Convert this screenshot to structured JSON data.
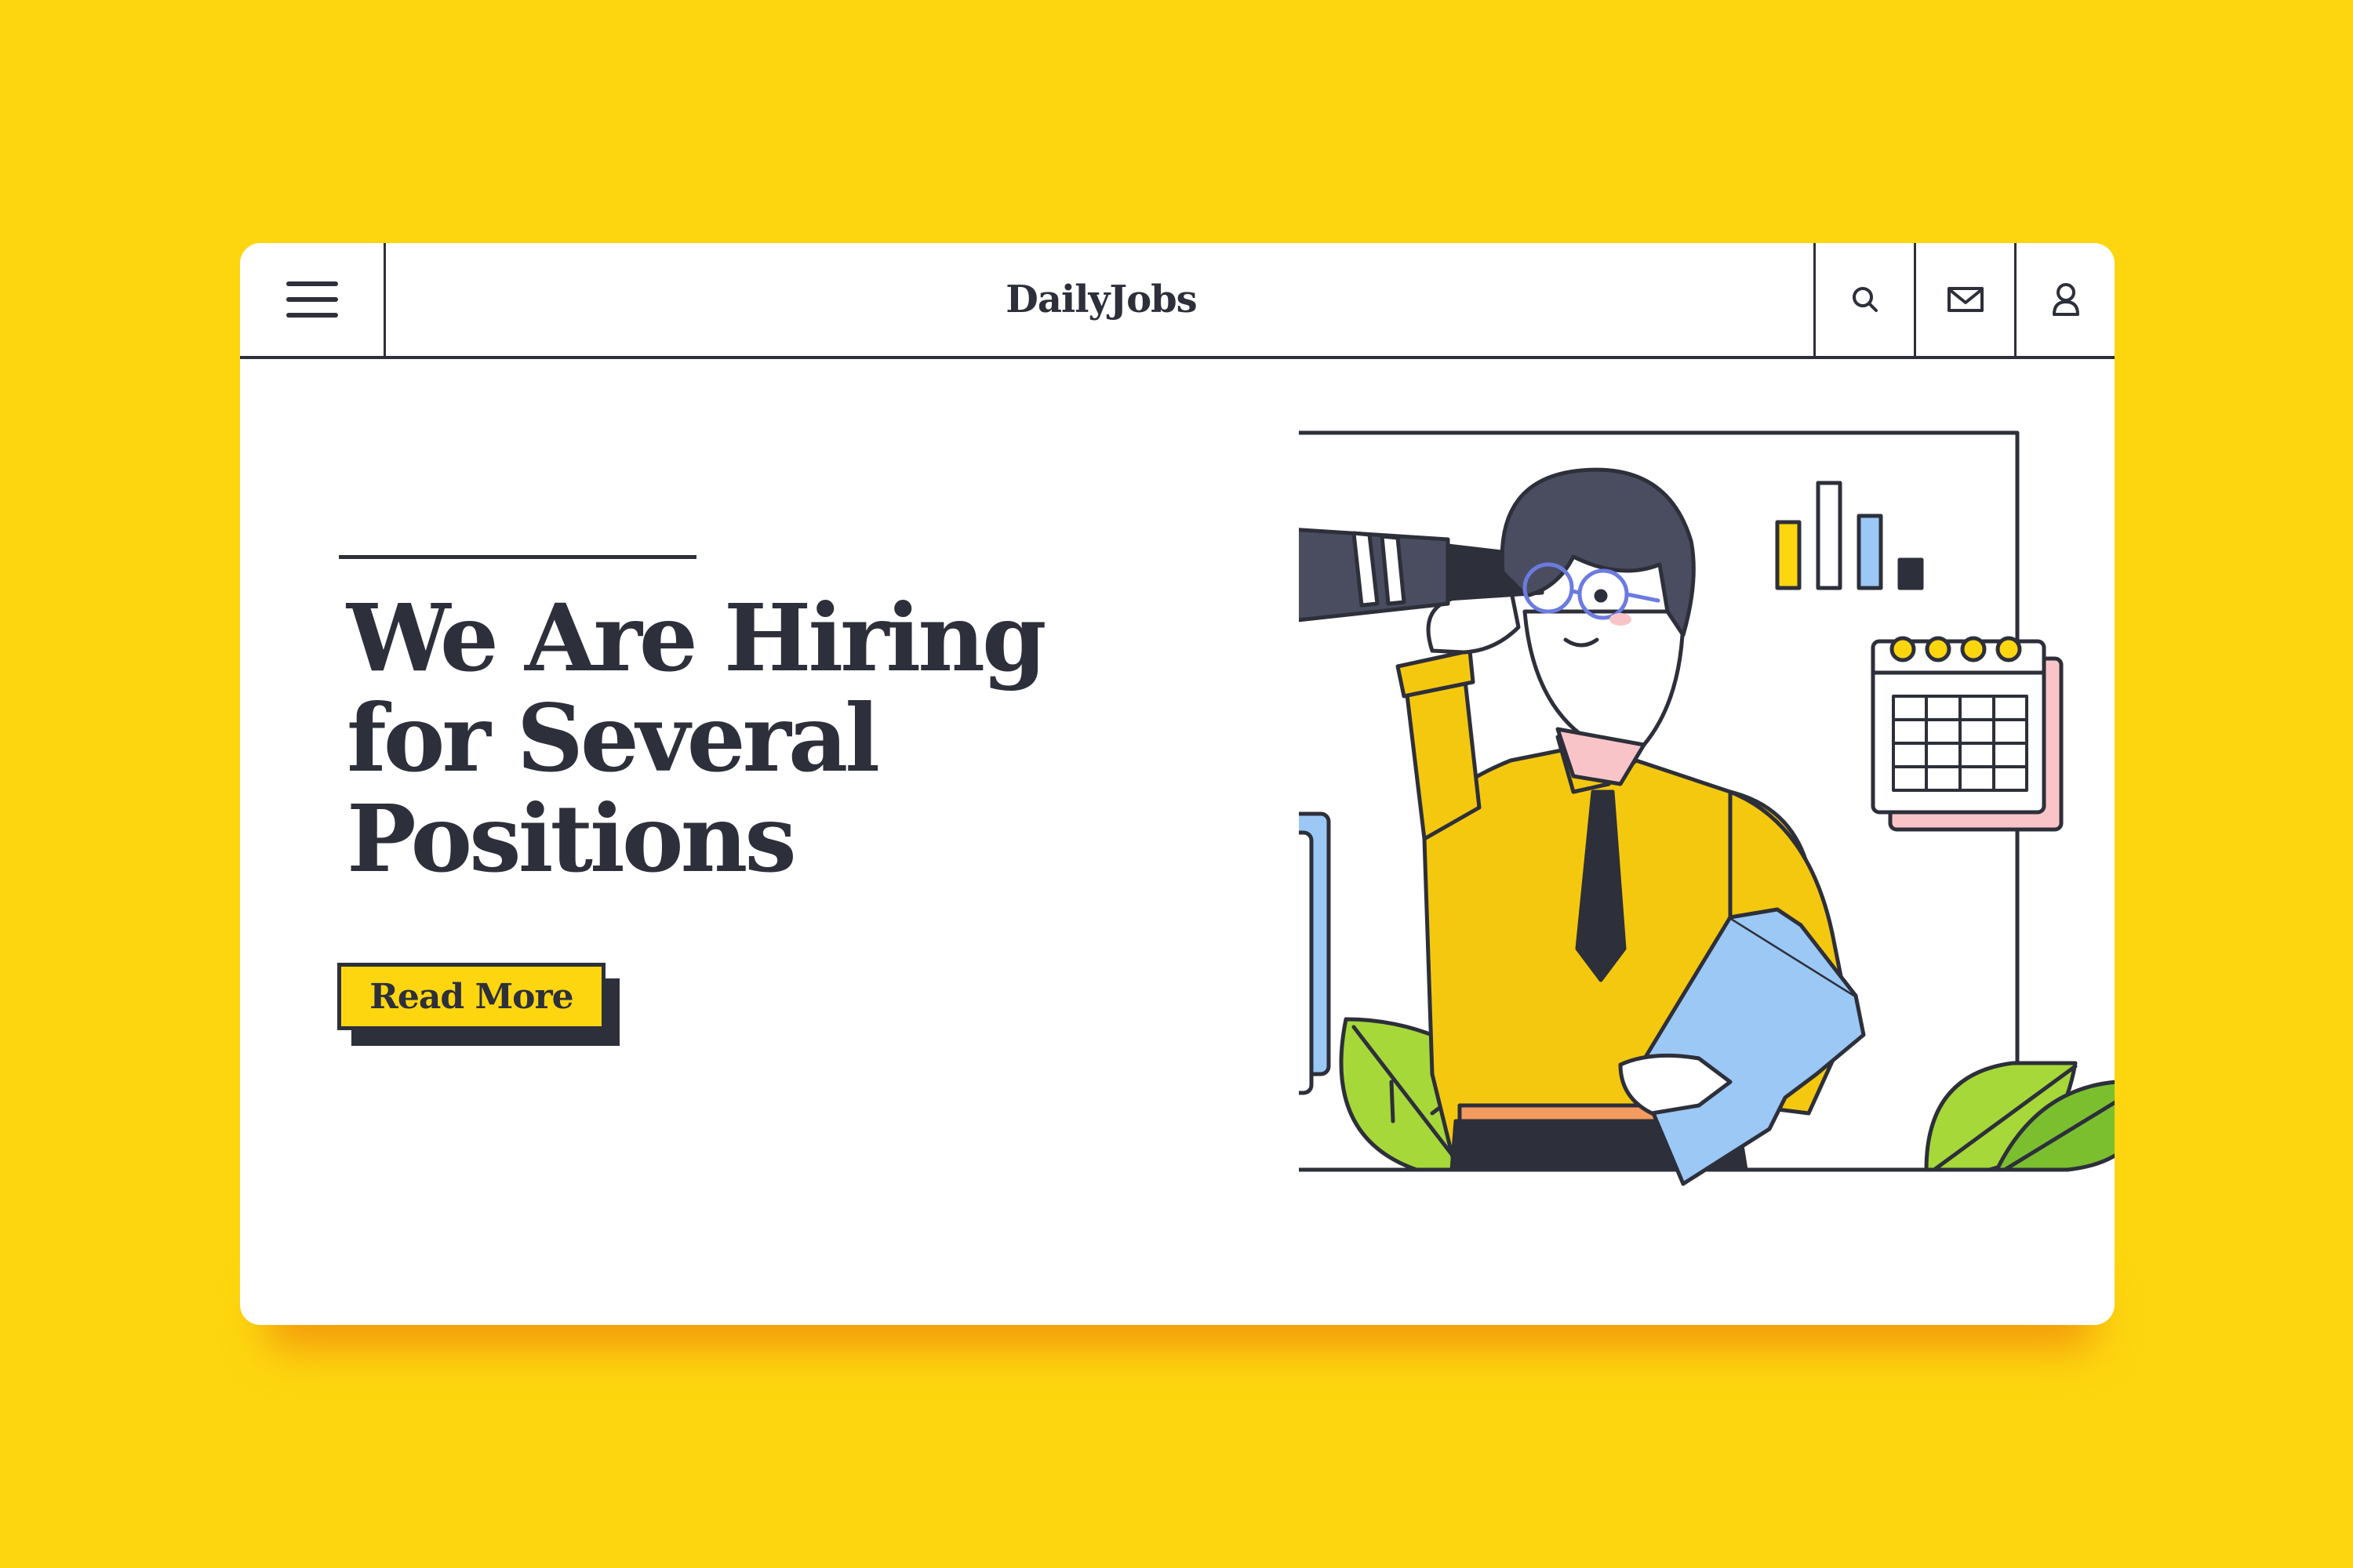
{
  "navbar": {
    "brand": "DailyJobs",
    "menu_icon": "hamburger-menu-icon",
    "actions": [
      {
        "name": "search",
        "icon": "search-icon"
      },
      {
        "name": "messages",
        "icon": "mail-icon"
      },
      {
        "name": "account",
        "icon": "user-icon"
      }
    ]
  },
  "hero": {
    "headline_lines": [
      "We Are Hiring",
      "for Several",
      "Positions"
    ],
    "cta_label": "Read More"
  },
  "colors": {
    "background": "#FDD60F",
    "accent": "#FDD60F",
    "text": "#2d2f3a",
    "card": "#ffffff"
  }
}
